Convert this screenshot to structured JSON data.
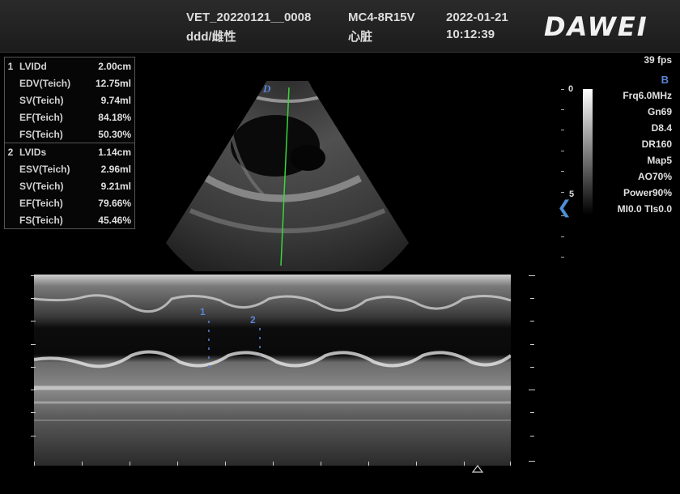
{
  "header": {
    "patient_id": "VET_20220121__0008",
    "patient_name": "ddd/雌性",
    "probe": "MC4-8R15V",
    "preset": "心脏",
    "date": "2022-01-21",
    "time": "10:12:39",
    "logo": "DAWEI"
  },
  "measurements": [
    {
      "index": "1",
      "rows": [
        {
          "label": "LVIDd",
          "value": "2.00cm"
        },
        {
          "label": "EDV(Teich)",
          "value": "12.75ml"
        },
        {
          "label": "SV(Teich)",
          "value": "9.74ml"
        },
        {
          "label": "EF(Teich)",
          "value": "84.18%"
        },
        {
          "label": "FS(Teich)",
          "value": "50.30%"
        }
      ]
    },
    {
      "index": "2",
      "rows": [
        {
          "label": "LVIDs",
          "value": "1.14cm"
        },
        {
          "label": "ESV(Teich)",
          "value": "2.96ml"
        },
        {
          "label": "SV(Teich)",
          "value": "9.21ml"
        },
        {
          "label": "EF(Teich)",
          "value": "79.66%"
        },
        {
          "label": "FS(Teich)",
          "value": "45.46%"
        }
      ]
    }
  ],
  "imaging": {
    "fps": "39 fps",
    "mode": "B",
    "params": [
      "Frq6.0MHz",
      "Gn69",
      "D8.4",
      "DR160",
      "Map5",
      "AO70%",
      "Power90%",
      "MI0.0 TIs0.0"
    ],
    "scale_top": "0",
    "scale_mid": "5",
    "sector_marker": "D",
    "mmode_marker_1": "1",
    "mmode_marker_2": "2"
  },
  "colors": {
    "accent": "#5a84d8",
    "cursor_line": "#39d639"
  }
}
